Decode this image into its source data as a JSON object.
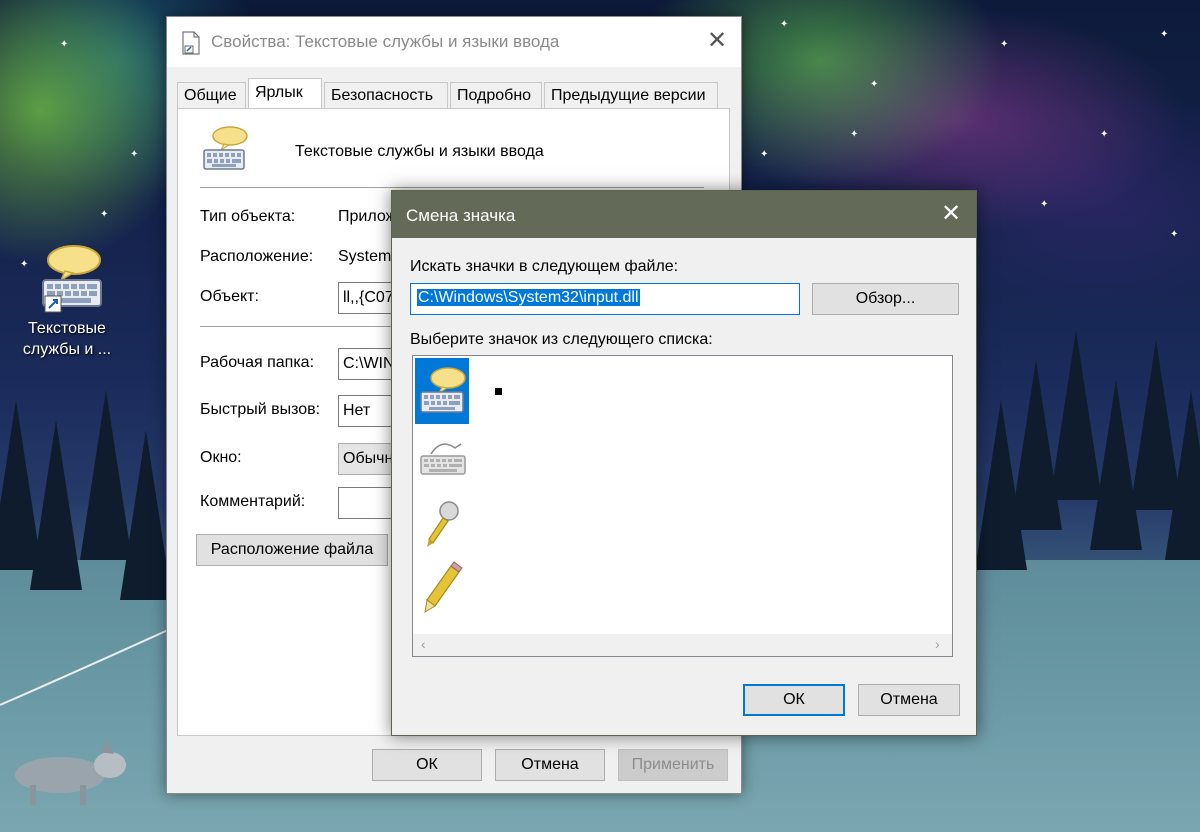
{
  "desktop": {
    "icon_label": "Текстовые службы и ..."
  },
  "properties_window": {
    "title": "Свойства: Текстовые службы и языки ввода",
    "tabs": [
      {
        "label": "Общие"
      },
      {
        "label": "Ярлык"
      },
      {
        "label": "Безопасность"
      },
      {
        "label": "Подробно"
      },
      {
        "label": "Предыдущие версии"
      }
    ],
    "active_tab": "Ярлык",
    "app_name": "Текстовые службы и языки ввода",
    "fields": {
      "object_type_label": "Тип объекта:",
      "object_type_value": "Прилож",
      "location_label": "Расположение:",
      "location_value": "System3",
      "target_label": "Объект:",
      "target_value": "ll,,{C07",
      "start_in_label": "Рабочая папка:",
      "start_in_value": "C:\\WIN",
      "shortcut_key_label": "Быстрый вызов:",
      "shortcut_key_value": "Нет",
      "run_label": "Окно:",
      "run_value": "Обычн",
      "comment_label": "Комментарий:",
      "comment_value": ""
    },
    "open_location_button": "Расположение файла",
    "buttons": {
      "ok": "ОК",
      "cancel": "Отмена",
      "apply": "Применить"
    }
  },
  "change_icon_dialog": {
    "title": "Смена значка",
    "search_label": "Искать значки в следующем файле:",
    "file_path": "C:\\Windows\\System32\\input.dll",
    "browse_button": "Обзор...",
    "list_label": "Выберите значок из следующего списка:",
    "icons": [
      {
        "name": "keyboard-speech-icon",
        "selected": true
      },
      {
        "name": "keyboard-pen-icon",
        "selected": false
      },
      {
        "name": "microphone-icon",
        "selected": false
      },
      {
        "name": "pencil-icon",
        "selected": false
      }
    ],
    "ok_button": "ОК",
    "cancel_button": "Отмена"
  },
  "colors": {
    "accent": "#0078d7",
    "dialog_title_bg": "#636b58",
    "window_bg": "#f0f0f0"
  }
}
